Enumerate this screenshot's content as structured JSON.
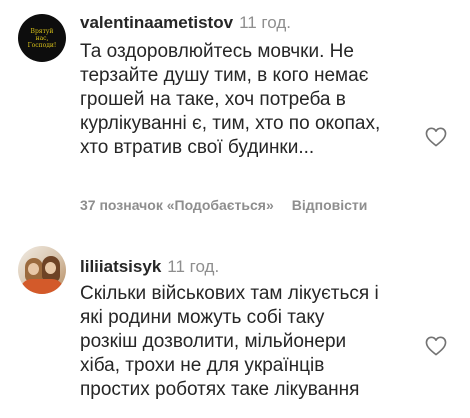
{
  "comments": [
    {
      "username": "valentinaametistov",
      "time": "11 год.",
      "avatar_text": "Врятуй нас, Господи!",
      "lines": [
        "Та оздоровлюйтесь мовчки. Не",
        "терзайте душу тим, в кого немає",
        "грошей на таке, хоч потреба в",
        "курлікуванні є, тим, хто по окопах,",
        "хто втратив свої будинки..."
      ],
      "likes_label": "37 позначок «Подобається»",
      "reply_label": "Відповісти"
    },
    {
      "username": "liliiatsisyk",
      "time": "11 год.",
      "lines": [
        "Скільки військових там лікується і",
        "які родини можуть собі таку",
        "розкіш дозволити, мільйонери",
        "хіба, трохи не для українців",
        "простих роботях таке лікування"
      ]
    }
  ],
  "icons": {
    "like": "heart-outline-icon"
  },
  "colors": {
    "text": "#262626",
    "secondary": "#8e8e8e",
    "avatar_logo": "#d9c21a"
  }
}
